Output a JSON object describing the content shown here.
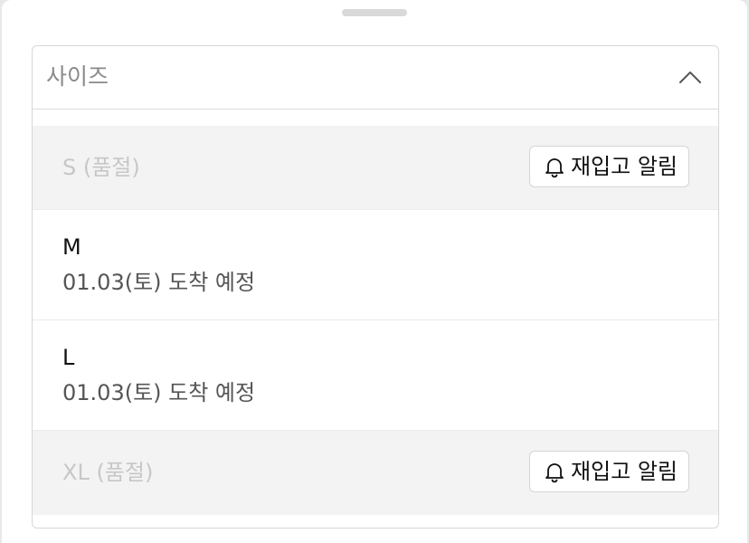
{
  "dropdown": {
    "title": "사이즈",
    "expanded": true
  },
  "options": [
    {
      "label": "S (품절)",
      "status": "soldout",
      "action_label": "재입고 알림"
    },
    {
      "label": "M",
      "status": "available",
      "arrival": "01.03(토) 도착 예정"
    },
    {
      "label": "L",
      "status": "available",
      "arrival": "01.03(토) 도착 예정"
    },
    {
      "label": "XL (품절)",
      "status": "soldout",
      "action_label": "재입고 알림"
    }
  ],
  "icons": {
    "collapse": "chevron-up-icon",
    "notify": "bell-icon"
  },
  "colors": {
    "soldout_row_bg": "#f3f3f3",
    "soldout_text": "#c7c7c7",
    "border": "#d7d7d7"
  }
}
